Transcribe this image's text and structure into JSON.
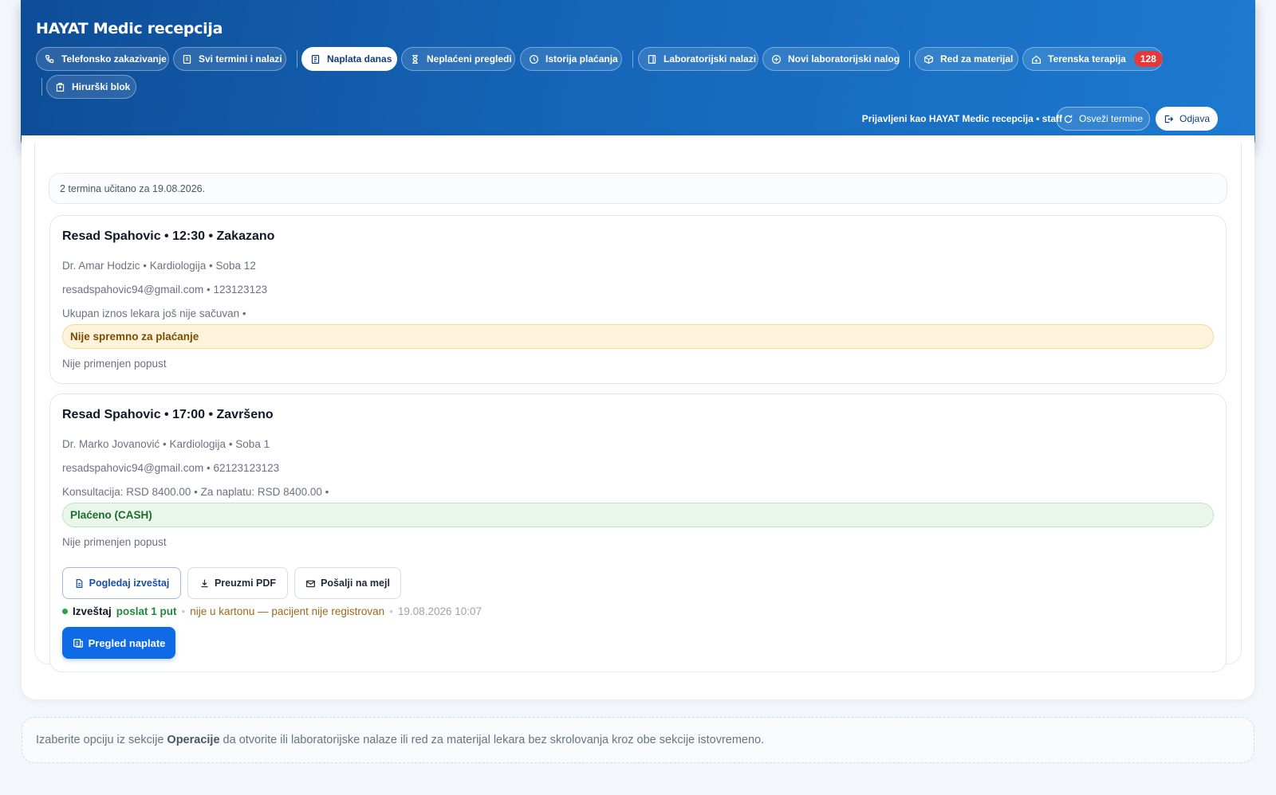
{
  "app": {
    "title": "HAYAT Medic recepcija"
  },
  "nav": [
    {
      "label": "Telefonsko zakazivanje",
      "icon": "phone-icon"
    },
    {
      "label": "Svi termini i nalazi",
      "icon": "calendar-list-icon"
    },
    {
      "label": "Naplata danas",
      "icon": "receipt-icon",
      "active": true
    },
    {
      "label": "Neplaćeni pregledi",
      "icon": "hourglass-icon"
    },
    {
      "label": "Istorija plaćanja",
      "icon": "clock-icon"
    },
    {
      "label": "Laboratorijski nalazi",
      "icon": "document-icon"
    },
    {
      "label": "Novi laboratorijski nalog",
      "icon": "plus-circle-icon"
    },
    {
      "label": "Red za materijal",
      "icon": "box-icon"
    },
    {
      "label": "Terenska terapija",
      "icon": "home-medical-icon",
      "badge": "128"
    },
    {
      "label": "Hirurški blok",
      "icon": "hospital-icon"
    }
  ],
  "user": {
    "info": "Prijavljeni kao HAYAT Medic recepcija • staff",
    "refresh_label": "Osveži termine",
    "logout_label": "Odjava"
  },
  "summary": "2 termina učitano za 19.08.2026.",
  "appointments": [
    {
      "title": "Resad Spahovic • 12:30 • Zakazano",
      "doctor_line": "Dr. Amar Hodzic • Kardiologija • Soba 12",
      "contact_line": "resadspahovic94@gmail.com • 123123123",
      "amount_line": "Ukupan iznos lekara još nije sačuvan •",
      "status": "Nije spremno za plaćanje",
      "discount": "Nije primenjen popust"
    },
    {
      "title": "Resad Spahovic • 17:00 • Završeno",
      "doctor_line": "Dr. Marko Jovanović • Kardiologija • Soba 1",
      "contact_line": "resadspahovic94@gmail.com • 62123123123",
      "amount_line": "Konsultacija: RSD 8400.00 • Za naplatu: RSD 8400.00 •",
      "status": "Plaćeno (CASH)",
      "discount": "Nije primenjen popust",
      "actions": {
        "view_report": "Pogledaj izveštaj",
        "download_pdf": "Preuzmi PDF",
        "send_email": "Pošalji na mejl"
      },
      "report": {
        "label": "Izveštaj",
        "sent": "poslat 1 put",
        "note": "nije u kartonu — pacijent nije registrovan",
        "time": "19.08.2026 10:07"
      },
      "billing_button": "Pregled naplate"
    }
  ],
  "footer": {
    "before": "Izaberite opciju iz sekcije ",
    "bold": "Operacije",
    "after": " da otvorite ili laboratorijske nalaze ili red za materijal lekara bez skrolovanja kroz obe sekcije istovremeno."
  },
  "colors": {
    "header_start": "#0e4d97",
    "header_end": "#1d7ad0",
    "primary": "#0f6ae6",
    "badge": "#e5383b",
    "warn_bg": "#fff3dc",
    "ok_bg": "#e8f7ea"
  }
}
